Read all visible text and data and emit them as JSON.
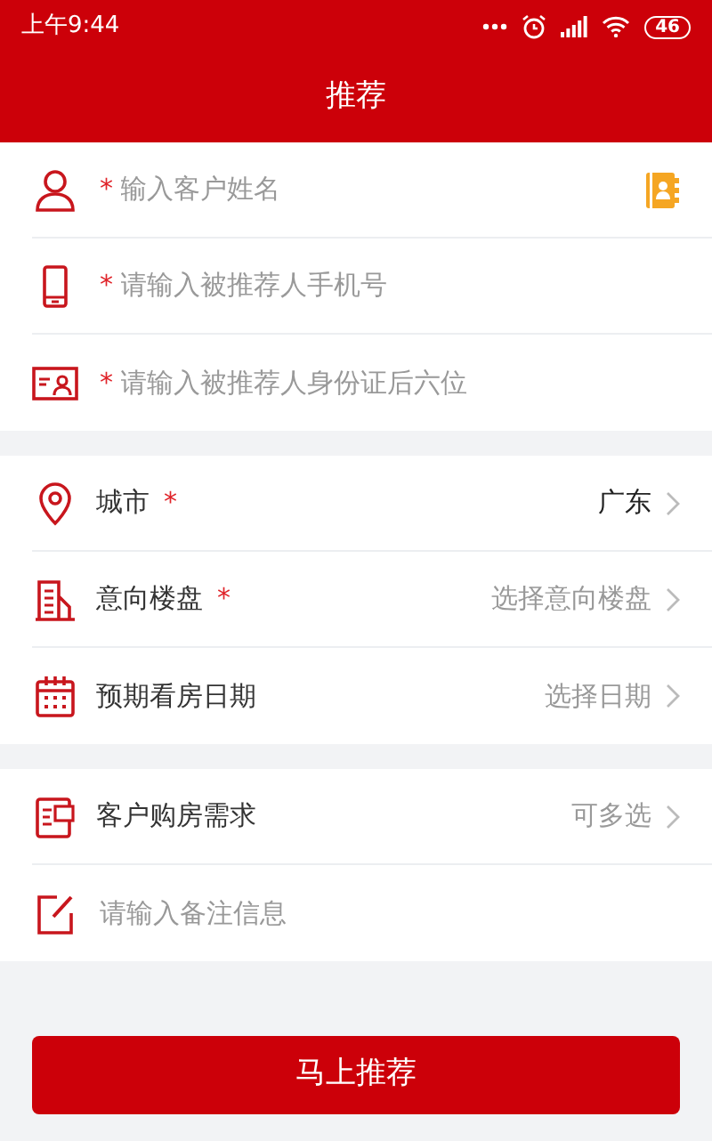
{
  "status_bar": {
    "time": "上午9:44",
    "battery": "46"
  },
  "header": {
    "title": "推荐"
  },
  "sections": [
    {
      "rows": [
        {
          "kind": "input",
          "required_mark": "*",
          "placeholder": "输入客户姓名",
          "contact_picker": true
        },
        {
          "kind": "input",
          "required_mark": "*",
          "placeholder": "请输入被推荐人手机号"
        },
        {
          "kind": "input",
          "required_mark": "*",
          "placeholder": "请输入被推荐人身份证后六位"
        }
      ]
    },
    {
      "rows": [
        {
          "kind": "select",
          "label": "城市",
          "required_mark": "*",
          "value": "广东"
        },
        {
          "kind": "select",
          "label": "意向楼盘",
          "required_mark": "*",
          "placeholder": "选择意向楼盘"
        },
        {
          "kind": "select",
          "label": "预期看房日期",
          "placeholder": "选择日期"
        }
      ]
    },
    {
      "rows": [
        {
          "kind": "select",
          "label": "客户购房需求",
          "placeholder": "可多选"
        },
        {
          "kind": "input",
          "placeholder": "请输入备注信息"
        }
      ]
    }
  ],
  "submit": {
    "label": "马上推荐"
  }
}
